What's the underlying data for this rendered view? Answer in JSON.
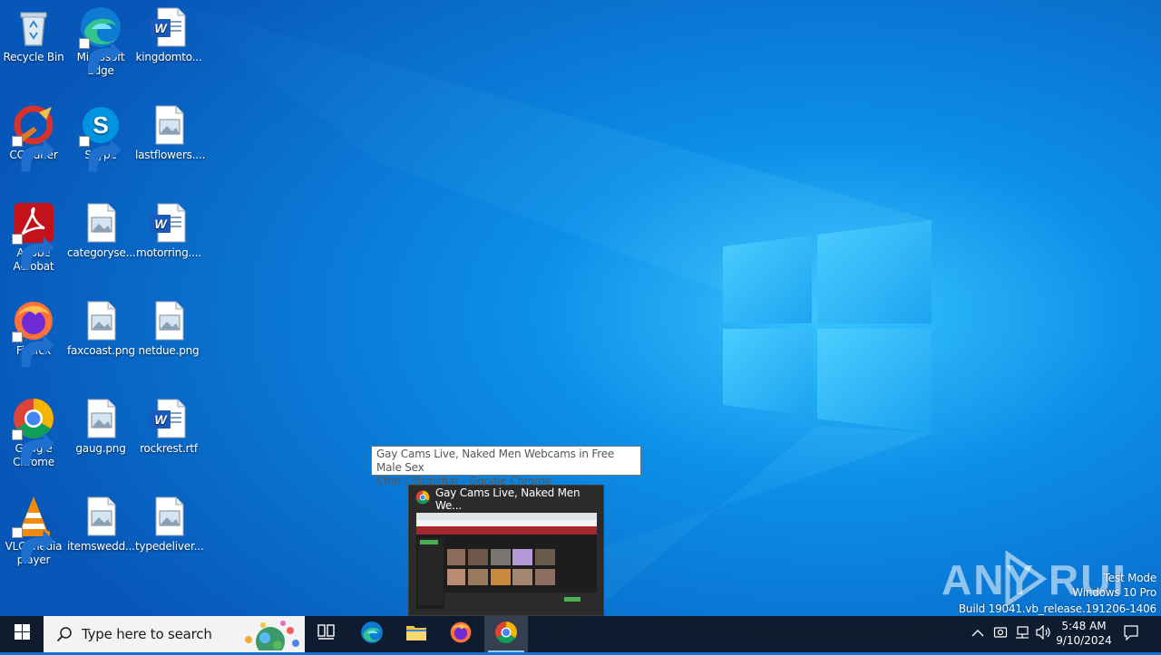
{
  "desktop": {
    "icons": [
      {
        "id": "recycle-bin",
        "label": "Recycle Bin",
        "icon": "recycle-bin-icon",
        "shortcut": false
      },
      {
        "id": "microsoft-edge",
        "label": "Microsoft Edge",
        "icon": "edge-icon",
        "shortcut": true
      },
      {
        "id": "kingdomto",
        "label": "kingdomto...",
        "icon": "word-document-icon",
        "shortcut": false
      },
      {
        "id": "ccleaner",
        "label": "CCleaner",
        "icon": "ccleaner-icon",
        "shortcut": true
      },
      {
        "id": "skype",
        "label": "Skype",
        "icon": "skype-icon",
        "shortcut": true
      },
      {
        "id": "lastflowers",
        "label": "lastflowers....",
        "icon": "image-file-icon",
        "shortcut": false
      },
      {
        "id": "adobe-acrobat",
        "label": "Adobe Acrobat",
        "icon": "acrobat-icon",
        "shortcut": true
      },
      {
        "id": "categoryse",
        "label": "categoryse...",
        "icon": "image-file-icon",
        "shortcut": false
      },
      {
        "id": "motorring",
        "label": "motorring....",
        "icon": "word-document-icon",
        "shortcut": false
      },
      {
        "id": "firefox",
        "label": "Firefox",
        "icon": "firefox-icon",
        "shortcut": true
      },
      {
        "id": "faxcoast",
        "label": "faxcoast.png",
        "icon": "image-file-icon",
        "shortcut": false
      },
      {
        "id": "netdue",
        "label": "netdue.png",
        "icon": "image-file-icon",
        "shortcut": false
      },
      {
        "id": "google-chrome",
        "label": "Google Chrome",
        "icon": "chrome-icon",
        "shortcut": true
      },
      {
        "id": "gaug",
        "label": "gaug.png",
        "icon": "image-file-icon",
        "shortcut": false
      },
      {
        "id": "rockrest",
        "label": "rockrest.rtf",
        "icon": "word-document-icon",
        "shortcut": false
      },
      {
        "id": "vlc",
        "label": "VLC media player",
        "icon": "vlc-icon",
        "shortcut": true
      },
      {
        "id": "itemswedd",
        "label": "itemswedd...",
        "icon": "image-file-icon",
        "shortcut": false
      },
      {
        "id": "typedeliver",
        "label": "typedeliver...",
        "icon": "image-file-icon",
        "shortcut": false
      }
    ]
  },
  "tooltip": {
    "text_line1": "Gay Cams Live, Naked Men Webcams in Free Male Sex",
    "text_line2": "Chat | Stripchat - Google Chrome"
  },
  "preview": {
    "title": "Gay Cams Live, Naked Men We...",
    "icon": "chrome-icon"
  },
  "watermark": {
    "logo_text": "ANY RUN",
    "line1": "Test Mode",
    "line2": "Windows 10 Pro",
    "line3": "Build 19041.vb_release.191206-1406"
  },
  "taskbar": {
    "start_icon": "windows-logo-icon",
    "search_placeholder": "Type here to search",
    "apps": [
      {
        "id": "task-view",
        "icon": "task-view-icon"
      },
      {
        "id": "edge",
        "icon": "edge-icon"
      },
      {
        "id": "file-explorer",
        "icon": "folder-icon"
      },
      {
        "id": "firefox",
        "icon": "firefox-icon"
      },
      {
        "id": "chrome",
        "icon": "chrome-icon",
        "active": true
      }
    ],
    "tray": {
      "icons": [
        "chevron-up-icon",
        "meet-now-icon",
        "network-icon",
        "volume-icon",
        "notification-icon"
      ],
      "time": "5:48 AM",
      "date": "9/10/2024"
    }
  },
  "colors": {
    "wallpaper_dark": "#0a5bb5",
    "wallpaper_light": "#1ea5f2",
    "taskbar": "#101828",
    "accent": "#8ec9ff"
  }
}
